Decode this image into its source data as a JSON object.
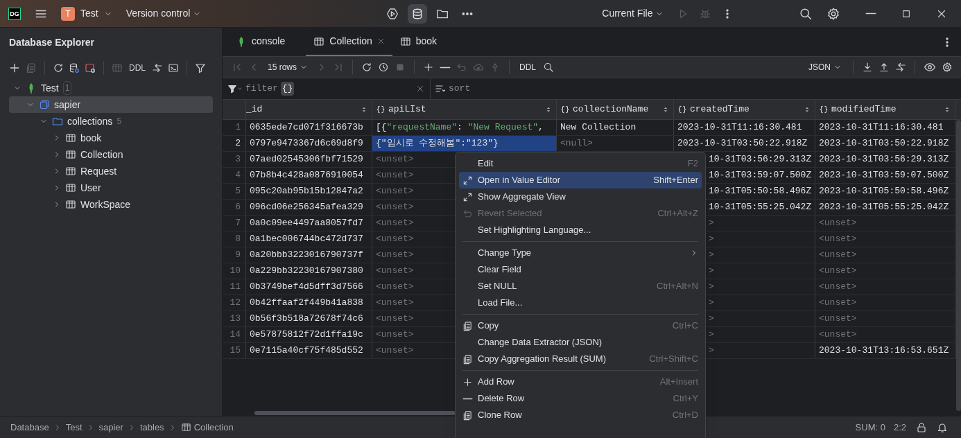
{
  "title_bar": {
    "logo_text": "DG",
    "project_initial": "T",
    "project": "Test",
    "vcs": "Version control",
    "run_config": "Current File"
  },
  "explorer": {
    "title": "Database Explorer",
    "ddl": "DDL",
    "tree": [
      {
        "label": "Test",
        "kind": "connection",
        "count": "1",
        "expanded": true,
        "selected": false,
        "children": [
          {
            "label": "sapier",
            "kind": "database",
            "expanded": true,
            "selected": true,
            "children": [
              {
                "label": "collections",
                "kind": "folder",
                "count": "5",
                "expanded": true,
                "selected": false,
                "children": [
                  {
                    "label": "book",
                    "kind": "table",
                    "expanded": false,
                    "selected": false
                  },
                  {
                    "label": "Collection",
                    "kind": "table",
                    "expanded": false,
                    "selected": false
                  },
                  {
                    "label": "Request",
                    "kind": "table",
                    "expanded": false,
                    "selected": false
                  },
                  {
                    "label": "User",
                    "kind": "table",
                    "expanded": false,
                    "selected": false
                  },
                  {
                    "label": "WorkSpace",
                    "kind": "table",
                    "expanded": false,
                    "selected": false
                  }
                ]
              }
            ]
          }
        ]
      }
    ]
  },
  "tabs": [
    {
      "label": "console",
      "kind": "console",
      "selected": false,
      "closable": false
    },
    {
      "label": "Collection",
      "kind": "table",
      "selected": true,
      "closable": true
    },
    {
      "label": "book",
      "kind": "table",
      "selected": false,
      "closable": false
    }
  ],
  "data_toolbar": {
    "rows": "15 rows",
    "ddl": "DDL",
    "format": "JSON"
  },
  "filter": {
    "label": "filter",
    "value": "{}"
  },
  "sort": {
    "label": "sort"
  },
  "table": {
    "columns": [
      {
        "label": "_id",
        "kind": "plain"
      },
      {
        "label": "apiLIst",
        "kind": "object"
      },
      {
        "label": "collectionName",
        "kind": "object"
      },
      {
        "label": "createdTime",
        "kind": "object"
      },
      {
        "label": "modifiedTime",
        "kind": "object"
      }
    ],
    "rows": [
      {
        "number": "1",
        "selected": false,
        "cells": [
          "0635ede7cd071f316673b",
          "[{\"requestName\": \"New Request\",",
          "New Collection",
          "2023-10-31T11:16:30.481",
          "2023-10-31T11:16:30.481"
        ]
      },
      {
        "number": "2",
        "selected": true,
        "cells": [
          "0797e9473367d6c69d8f9",
          {
            "text": "{\"임시로 수정해봄\":\"123\"}",
            "kind": "text",
            "selected": true
          },
          {
            "text": "<null>",
            "kind": "placeholder"
          },
          "2023-10-31T03:50:22.918Z",
          "2023-10-31T03:50:22.918Z"
        ]
      },
      {
        "number": "3",
        "selected": false,
        "cells": [
          "07aed02545306fbf71529",
          {
            "text": "<unset>",
            "kind": "unset"
          },
          null,
          "10-31T03:56:29.313Z",
          "2023-10-31T03:56:29.313Z"
        ]
      },
      {
        "number": "4",
        "selected": false,
        "cells": [
          "07b8b4c428a0876910054",
          {
            "text": "<unset>",
            "kind": "unset"
          },
          null,
          "10-31T03:59:07.500Z",
          "2023-10-31T03:59:07.500Z"
        ]
      },
      {
        "number": "5",
        "selected": false,
        "cells": [
          "095c20ab95b15b12847a2",
          {
            "text": "<unset>",
            "kind": "unset"
          },
          null,
          "10-31T05:50:58.496Z",
          "2023-10-31T05:50:58.496Z"
        ]
      },
      {
        "number": "6",
        "selected": false,
        "cells": [
          "096cd06e256345afea329",
          {
            "text": "<unset>",
            "kind": "unset"
          },
          null,
          "10-31T05:55:25.042Z",
          "2023-10-31T05:55:25.042Z"
        ]
      },
      {
        "number": "7",
        "selected": false,
        "cells": [
          "0a0c09ee4497aa8057fd7",
          {
            "text": "<unset>",
            "kind": "unset"
          },
          null,
          {
            "text": ">",
            "kind": "unset"
          },
          {
            "text": "<unset>",
            "kind": "unset"
          }
        ]
      },
      {
        "number": "8",
        "selected": false,
        "cells": [
          "0a1bec006744bc472d737",
          {
            "text": "<unset>",
            "kind": "unset"
          },
          null,
          {
            "text": ">",
            "kind": "unset"
          },
          {
            "text": "<unset>",
            "kind": "unset"
          }
        ]
      },
      {
        "number": "9",
        "selected": false,
        "cells": [
          "0a20bbb3223016790737f",
          {
            "text": "<unset>",
            "kind": "unset"
          },
          null,
          {
            "text": ">",
            "kind": "unset"
          },
          {
            "text": "<unset>",
            "kind": "unset"
          }
        ]
      },
      {
        "number": "10",
        "selected": false,
        "cells": [
          "0a229bb32230167907380",
          {
            "text": "<unset>",
            "kind": "unset"
          },
          null,
          {
            "text": ">",
            "kind": "unset"
          },
          {
            "text": "<unset>",
            "kind": "unset"
          }
        ]
      },
      {
        "number": "11",
        "selected": false,
        "cells": [
          "0b3749bef4d5dff3d7566",
          {
            "text": "<unset>",
            "kind": "unset"
          },
          null,
          {
            "text": ">",
            "kind": "unset"
          },
          {
            "text": "<unset>",
            "kind": "unset"
          }
        ]
      },
      {
        "number": "12",
        "selected": false,
        "cells": [
          "0b42ffaaf2f449b41a838",
          {
            "text": "<unset>",
            "kind": "unset"
          },
          null,
          {
            "text": ">",
            "kind": "unset"
          },
          {
            "text": "<unset>",
            "kind": "unset"
          }
        ]
      },
      {
        "number": "13",
        "selected": false,
        "cells": [
          "0b56f3b518a72678f74c6",
          {
            "text": "<unset>",
            "kind": "unset"
          },
          null,
          {
            "text": ">",
            "kind": "unset"
          },
          {
            "text": "<unset>",
            "kind": "unset"
          }
        ]
      },
      {
        "number": "14",
        "selected": false,
        "cells": [
          "0e57875812f72d1ffa19c",
          {
            "text": "<unset>",
            "kind": "unset"
          },
          null,
          {
            "text": ">",
            "kind": "unset"
          },
          {
            "text": "<unset>",
            "kind": "unset"
          }
        ]
      },
      {
        "number": "15",
        "selected": false,
        "cells": [
          "0e7115a40cf75f485d552",
          {
            "text": "<unset>",
            "kind": "unset"
          },
          null,
          {
            "text": ">",
            "kind": "unset"
          },
          "2023-10-31T13:16:53.651Z"
        ]
      }
    ]
  },
  "context_menu": [
    {
      "kind": "plain",
      "label": "Edit",
      "shortcut": "F2",
      "highlighted": false,
      "disabled": false,
      "submenu": false
    },
    {
      "kind": "expand",
      "label": "Open in Value Editor",
      "shortcut": "Shift+Enter",
      "highlighted": true,
      "disabled": false,
      "submenu": false
    },
    {
      "kind": "expand",
      "label": "Show Aggregate View",
      "highlighted": false,
      "disabled": false,
      "submenu": false
    },
    {
      "kind": "revert",
      "label": "Revert Selected",
      "shortcut": "Ctrl+Alt+Z",
      "highlighted": false,
      "disabled": true,
      "submenu": false
    },
    {
      "kind": "plain",
      "label": "Set Highlighting Language...",
      "highlighted": false,
      "disabled": false,
      "submenu": false
    },
    {
      "kind": "separator"
    },
    {
      "kind": "plain",
      "label": "Change Type",
      "highlighted": false,
      "disabled": false,
      "submenu": true
    },
    {
      "kind": "plain",
      "label": "Clear Field",
      "highlighted": false,
      "disabled": false,
      "submenu": false
    },
    {
      "kind": "plain",
      "label": "Set NULL",
      "shortcut": "Ctrl+Alt+N",
      "highlighted": false,
      "disabled": false,
      "submenu": false
    },
    {
      "kind": "plain",
      "label": "Load File...",
      "highlighted": false,
      "disabled": false,
      "submenu": false
    },
    {
      "kind": "separator"
    },
    {
      "kind": "copy",
      "label": "Copy",
      "shortcut": "Ctrl+C",
      "highlighted": false,
      "disabled": false,
      "submenu": false
    },
    {
      "kind": "plain",
      "label": "Change Data Extractor (JSON)",
      "highlighted": false,
      "disabled": false,
      "submenu": false
    },
    {
      "kind": "copy",
      "label": "Copy Aggregation Result (SUM)",
      "shortcut": "Ctrl+Shift+C",
      "highlighted": false,
      "disabled": false,
      "submenu": false
    },
    {
      "kind": "separator"
    },
    {
      "kind": "add",
      "label": "Add Row",
      "shortcut": "Alt+Insert",
      "highlighted": false,
      "disabled": false,
      "submenu": false
    },
    {
      "kind": "delete",
      "label": "Delete Row",
      "shortcut": "Ctrl+Y",
      "highlighted": false,
      "disabled": false,
      "submenu": false
    },
    {
      "kind": "copy",
      "label": "Clone Row",
      "shortcut": "Ctrl+D",
      "highlighted": false,
      "disabled": false,
      "submenu": false
    }
  ],
  "status_bar": {
    "breadcrumbs": [
      {
        "label": "Database",
        "kind": "plain"
      },
      {
        "label": "Test",
        "kind": "plain"
      },
      {
        "label": "sapier",
        "kind": "plain"
      },
      {
        "label": "tables",
        "kind": "plain"
      },
      {
        "label": "Collection",
        "kind": "table"
      }
    ],
    "sum": "SUM: 0",
    "position": "2:2"
  }
}
